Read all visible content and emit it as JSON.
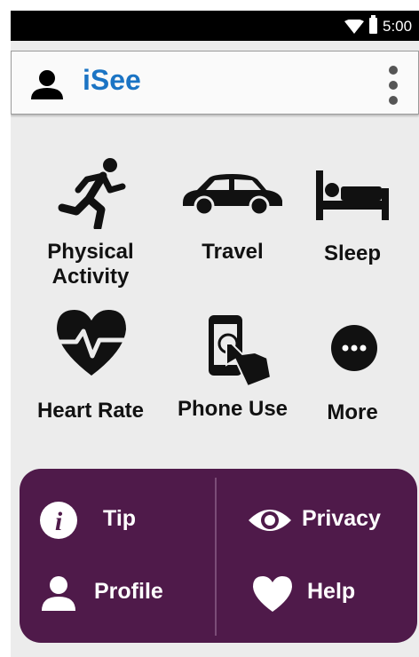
{
  "status_bar": {
    "time": "5:00"
  },
  "app_bar": {
    "title": "iSee",
    "title_color": "#1b74c4"
  },
  "grid": {
    "tiles": [
      {
        "label_line1": "Physical",
        "label_line2": "Activity",
        "icon": "running-person-icon"
      },
      {
        "label": "Travel",
        "icon": "car-icon"
      },
      {
        "label": "Sleep",
        "icon": "bed-icon"
      },
      {
        "label": "Heart Rate",
        "icon": "heart-rate-icon"
      },
      {
        "label": "Phone Use",
        "icon": "phone-touch-icon"
      },
      {
        "label": "More",
        "icon": "more-dots-icon"
      }
    ]
  },
  "panel": {
    "background": "#4f1a4a",
    "items": [
      {
        "label": "Tip",
        "icon": "info-icon"
      },
      {
        "label": "Privacy",
        "icon": "eye-icon"
      },
      {
        "label": "Profile",
        "icon": "profile-icon"
      },
      {
        "label": "Help",
        "icon": "heart-icon"
      }
    ]
  }
}
